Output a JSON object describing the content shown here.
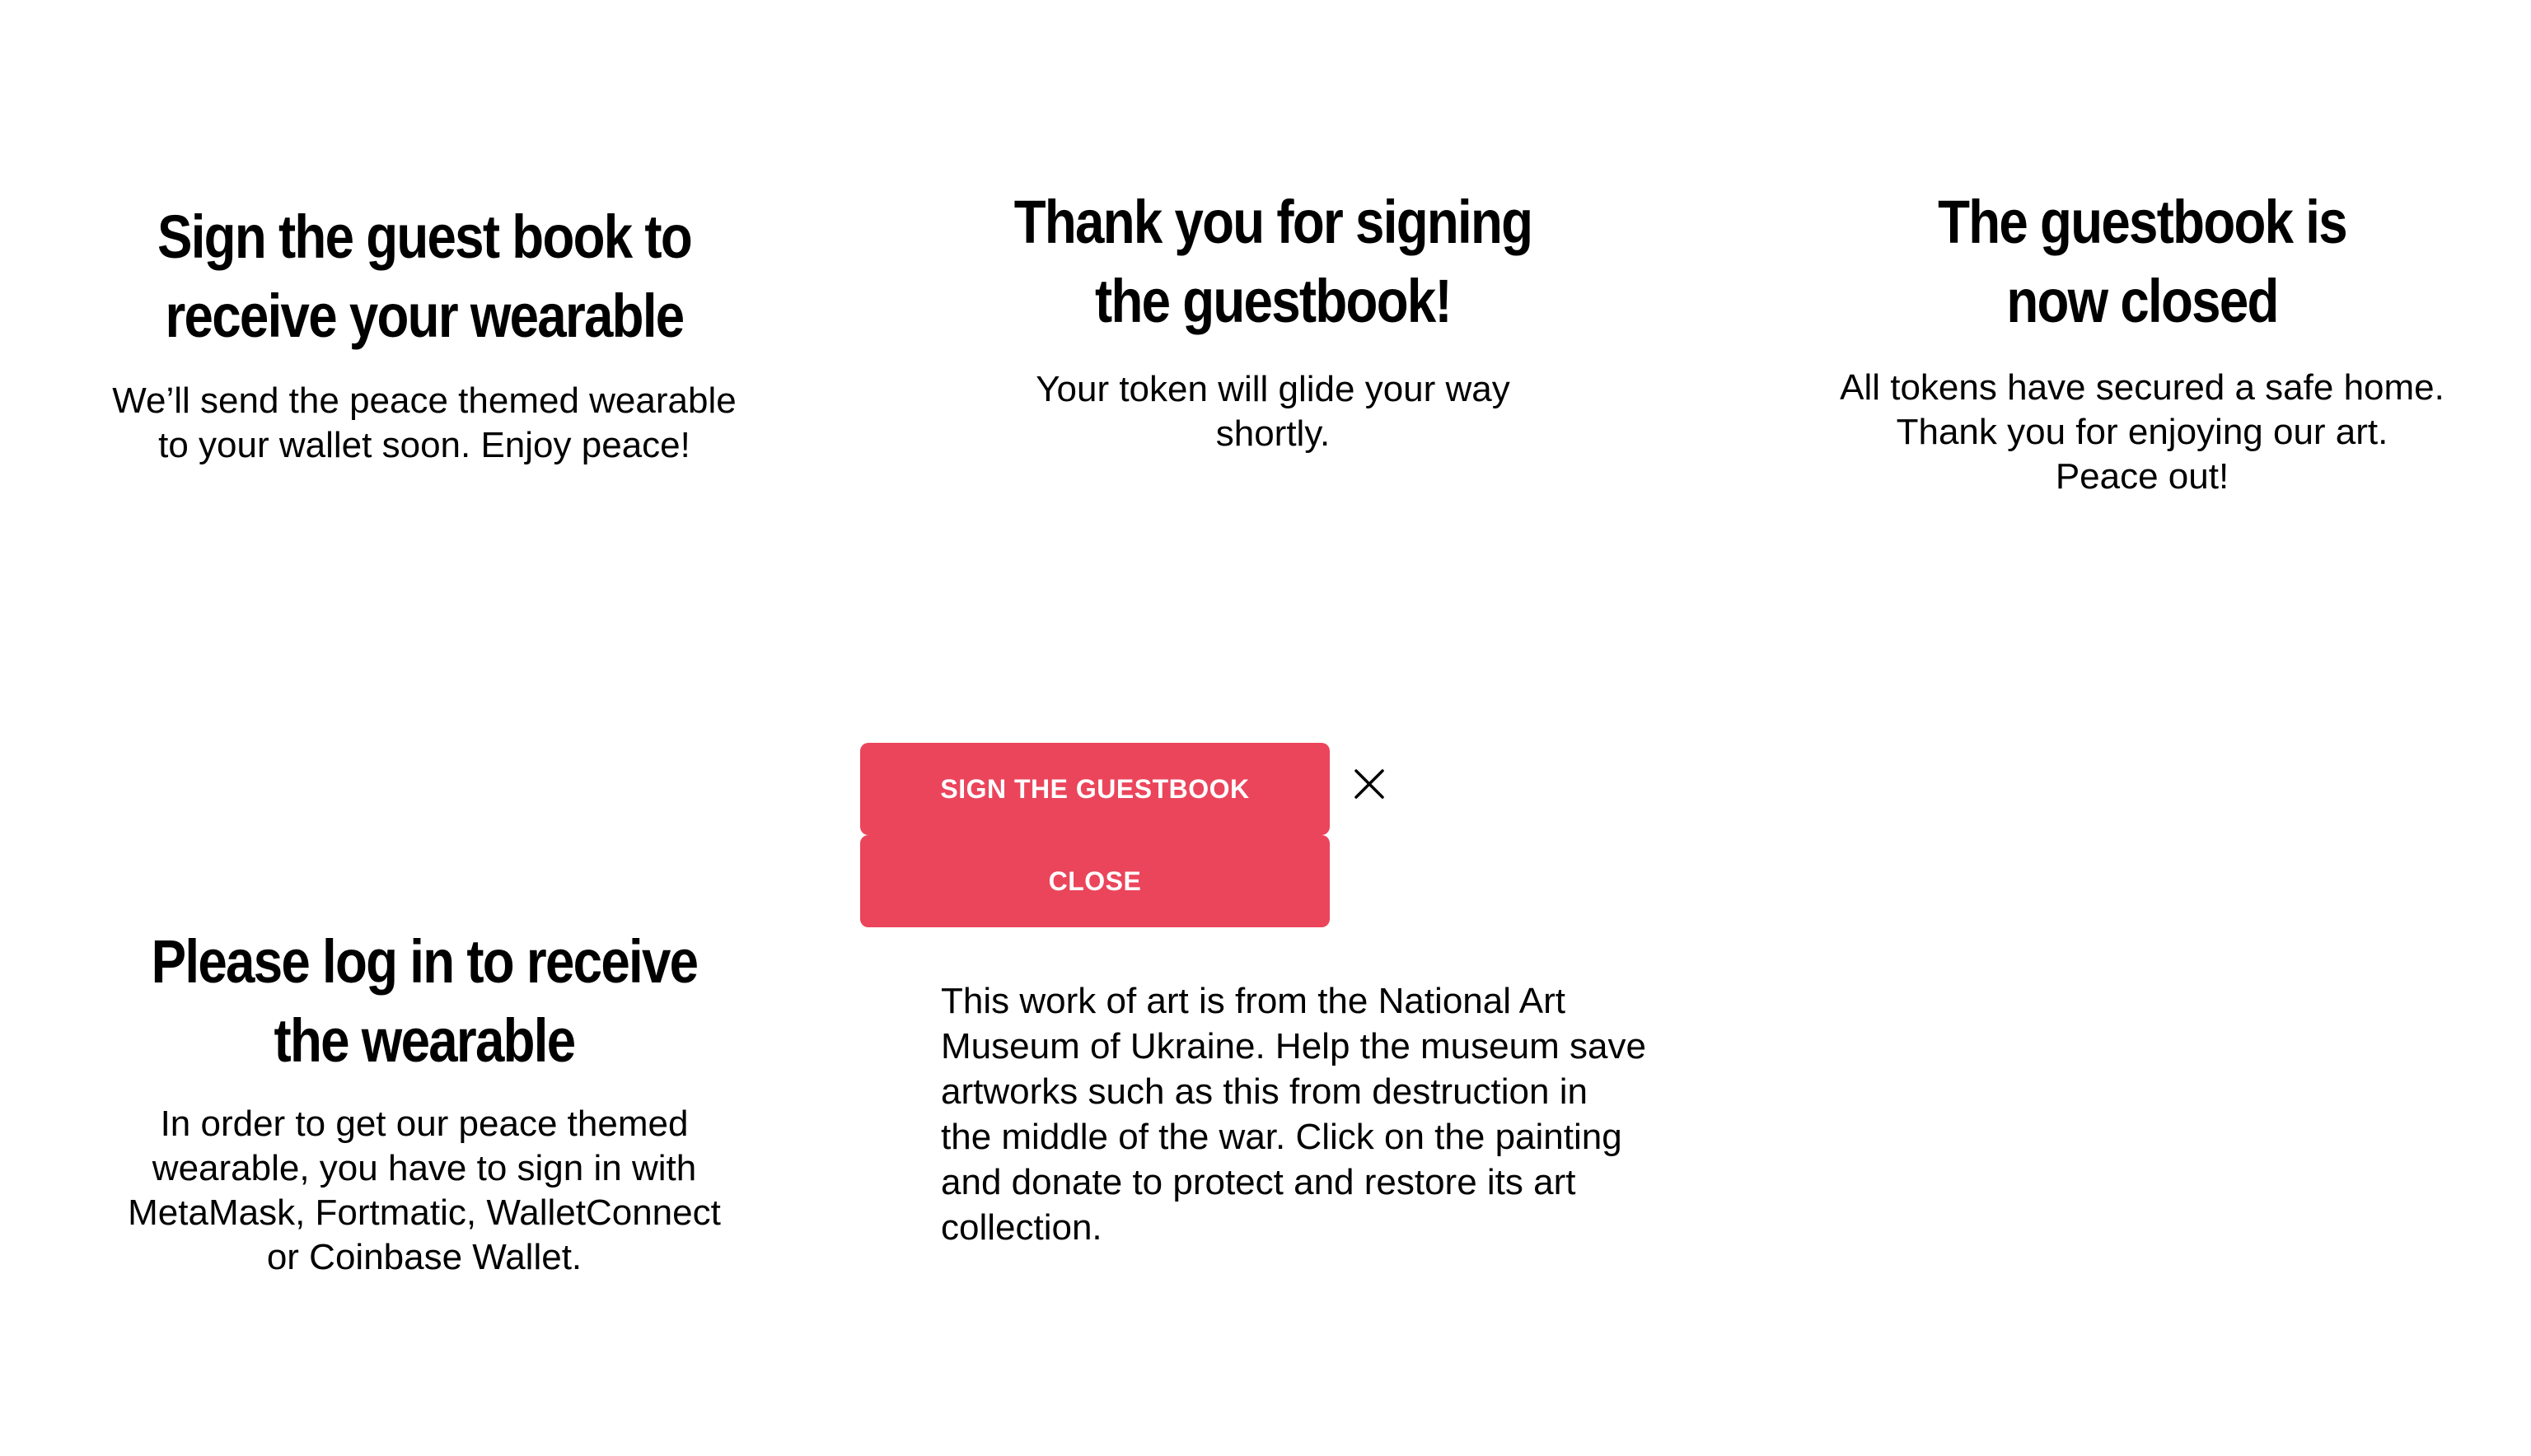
{
  "panels": {
    "sign": {
      "heading_lines": [
        "Sign the guest book to",
        "receive your wearable"
      ],
      "body_lines": [
        "We’ll send the peace themed wearable",
        "to your wallet soon. Enjoy peace!"
      ]
    },
    "thanks": {
      "heading_lines": [
        "Thank you for signing",
        "the guestbook!"
      ],
      "body_lines": [
        "Your token will glide your way",
        "shortly."
      ]
    },
    "closed": {
      "heading_lines": [
        "The guestbook is",
        "now closed"
      ],
      "body_lines": [
        "All tokens have secured a safe home.",
        "Thank you for enjoying our art.",
        "Peace out!"
      ]
    },
    "login": {
      "heading_lines": [
        "Please log in to receive",
        "the wearable"
      ],
      "body_lines": [
        "In order to get our peace themed",
        "wearable, you have to sign in with",
        "MetaMask, Fortmatic, WalletConnect",
        "or Coinbase Wallet."
      ]
    }
  },
  "buttons": {
    "sign_label": "SIGN THE GUESTBOOK",
    "close_label": "CLOSE",
    "close_icon": "close-x-icon"
  },
  "museum": {
    "lines": [
      "This work of art is from the National Art",
      "Museum of Ukraine. Help the museum save",
      "artworks such as this from destruction in",
      "the middle of the war. Click on the painting",
      "and donate to protect and restore its art",
      "collection."
    ]
  },
  "colors": {
    "button_bg": "#eb455c",
    "button_text": "#ffffff",
    "text": "#000000",
    "background": "#ffffff"
  }
}
